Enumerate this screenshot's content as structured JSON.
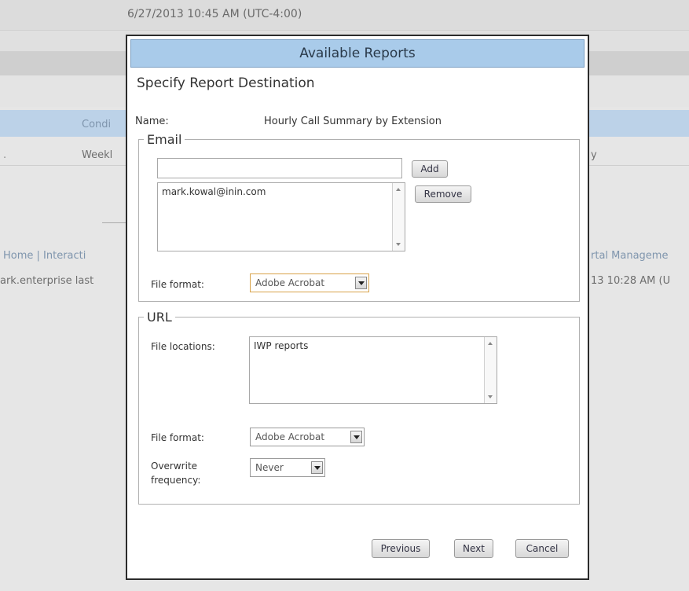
{
  "background": {
    "timestamp": "6/27/2013 10:45 AM (UTC-4:00)",
    "column_label": "Condi",
    "row_left_fragment": ".",
    "row_label": "Weekl",
    "row_right_fragment": "y",
    "nav_left": "Home | Interacti",
    "nav_right": "rtal Manageme",
    "user_left": "ark.enterprise last",
    "user_right": "13 10:28 AM (U"
  },
  "dialog": {
    "title": "Available Reports",
    "subtitle": "Specify Report Destination",
    "name_label": "Name:",
    "name_value": "Hourly Call Summary by Extension",
    "email": {
      "legend": "Email",
      "input_value": "",
      "add_label": "Add",
      "remove_label": "Remove",
      "addresses": [
        "mark.kowal@inin.com"
      ],
      "file_format_label": "File format:",
      "file_format_value": "Adobe Acrobat"
    },
    "url": {
      "legend": "URL",
      "locations_label": "File locations:",
      "locations": [
        "IWP reports"
      ],
      "file_format_label": "File format:",
      "file_format_value": "Adobe Acrobat",
      "overwrite_label": "Overwrite frequency:",
      "overwrite_value": "Never"
    },
    "buttons": {
      "previous": "Previous",
      "next": "Next",
      "cancel": "Cancel"
    }
  },
  "colors": {
    "title_bar": "#a9cbea",
    "page_bg": "#e6e6e6",
    "focus_border": "#d8a34a"
  }
}
